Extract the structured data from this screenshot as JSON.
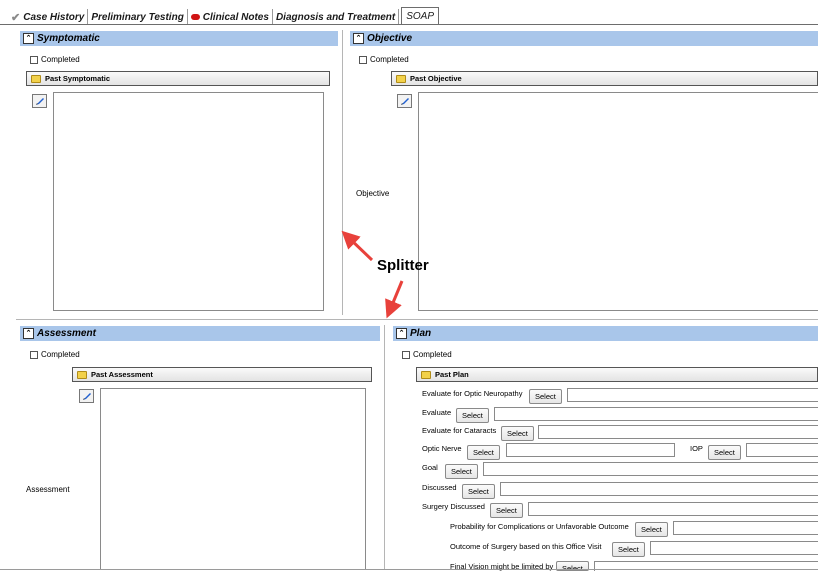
{
  "tabs": [
    {
      "label": "Case History"
    },
    {
      "label": "Preliminary Testing"
    },
    {
      "label": "Clinical Notes"
    },
    {
      "label": "Diagnosis and Treatment"
    },
    {
      "label": "SOAP"
    }
  ],
  "common": {
    "completed": "Completed"
  },
  "symptomatic": {
    "title": "Symptomatic",
    "past": "Past Symptomatic"
  },
  "objective": {
    "title": "Objective",
    "past": "Past Objective",
    "side_label": "Objective"
  },
  "assessment": {
    "title": "Assessment",
    "past": "Past Assessment",
    "side_label": "Assessment"
  },
  "plan": {
    "title": "Plan",
    "past": "Past Plan",
    "select": "Select",
    "rows": {
      "optic_neuropathy": "Evaluate for Optic Neuropathy",
      "evaluate": "Evaluate",
      "cataracts": "Evaluate for Cataracts",
      "optic_nerve": "Optic Nerve",
      "iop": "IOP",
      "goal": "Goal",
      "discussed": "Discussed",
      "surgery_discussed": "Surgery Discussed",
      "probability": "Probability for Complications or Unfavorable Outcome",
      "outcome": "Outcome of Surgery based on this Office Visit",
      "final_vision": "Final Vision might be limited by"
    }
  },
  "annotation": {
    "text": "Splitter",
    "color": "#e8413b"
  }
}
